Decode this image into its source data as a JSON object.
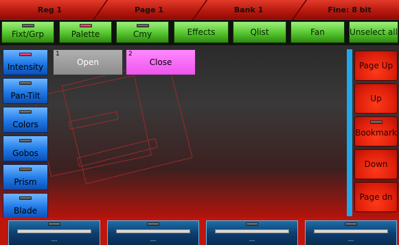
{
  "status_bar": {
    "reg": "Reg 1",
    "page": "Page 1",
    "bank": "Bank 1",
    "fine": "Fine: 8 bit"
  },
  "toolbar": {
    "fixt_grp": "Fixt/Grp",
    "palette": "Palette",
    "cmy": "Cmy",
    "effects": "Effects",
    "qlist": "Qlist",
    "fan": "Fan",
    "unselect_all": "Unselect all"
  },
  "attributes": {
    "intensity": "Intensity",
    "pan_tilt": "Pan-Tilt",
    "colors": "Colors",
    "gobos": "Gobos",
    "prism": "Prism",
    "blade": "Blade"
  },
  "presets": [
    {
      "number": "1",
      "label": "Open",
      "color": "#9e9e9e"
    },
    {
      "number": "2",
      "label": "Close",
      "color": "#ff6fff"
    }
  ],
  "navigation": {
    "page_up": "Page Up",
    "up": "Up",
    "bookmark": "Bookmark",
    "down": "Down",
    "page_dn": "Page dn"
  },
  "faders": [
    {
      "label": "---"
    },
    {
      "label": "---"
    },
    {
      "label": "---"
    },
    {
      "label": "---"
    }
  ],
  "colors": {
    "accent_green": "#56c52f",
    "accent_blue": "#1f79e6",
    "accent_red": "#e0200b",
    "track_blue": "#22a7e8",
    "led_active": "#e23a6a"
  }
}
